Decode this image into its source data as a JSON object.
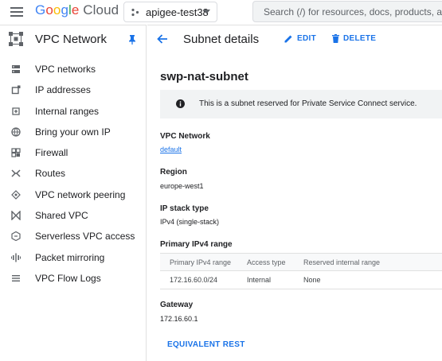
{
  "topbar": {
    "logo_google": [
      "G",
      "o",
      "o",
      "g",
      "l",
      "e"
    ],
    "logo_cloud": "Cloud",
    "project_name": "apigee-test38",
    "search_placeholder": "Search (/) for resources, docs, products, and more"
  },
  "sidebar": {
    "title": "VPC Network",
    "items": [
      {
        "label": "VPC networks",
        "icon": "vpc-networks-icon"
      },
      {
        "label": "IP addresses",
        "icon": "ip-addresses-icon"
      },
      {
        "label": "Internal ranges",
        "icon": "internal-ranges-icon"
      },
      {
        "label": "Bring your own IP",
        "icon": "globe-icon"
      },
      {
        "label": "Firewall",
        "icon": "firewall-icon"
      },
      {
        "label": "Routes",
        "icon": "routes-icon"
      },
      {
        "label": "VPC network peering",
        "icon": "peering-icon"
      },
      {
        "label": "Shared VPC",
        "icon": "shared-vpc-icon"
      },
      {
        "label": "Serverless VPC access",
        "icon": "serverless-icon"
      },
      {
        "label": "Packet mirroring",
        "icon": "packet-mirroring-icon"
      },
      {
        "label": "VPC Flow Logs",
        "icon": "flow-logs-icon"
      }
    ]
  },
  "main": {
    "title": "Subnet details",
    "edit_label": "EDIT",
    "delete_label": "DELETE",
    "subnet_name": "swp-nat-subnet",
    "banner_text": "This is a subnet reserved for Private Service Connect service.",
    "vpc_network_label": "VPC Network",
    "vpc_network_value": "default",
    "region_label": "Region",
    "region_value": "europe-west1",
    "ip_stack_label": "IP stack type",
    "ip_stack_value": "IPv4 (single-stack)",
    "primary_range_label": "Primary IPv4 range",
    "table": {
      "headers": [
        "Primary IPv4 range",
        "Access type",
        "Reserved internal range"
      ],
      "rows": [
        [
          "172.16.60.0/24",
          "Internal",
          "None"
        ]
      ]
    },
    "gateway_label": "Gateway",
    "gateway_value": "172.16.60.1",
    "equivalent_rest_label": "EQUIVALENT REST"
  },
  "colors": {
    "accent": "#1a73e8",
    "banner_bg": "#f1f3f4",
    "text": "#202124",
    "google_blue": "#4285f4",
    "google_red": "#ea4335",
    "google_yellow": "#fbbc05",
    "google_green": "#34a853"
  }
}
